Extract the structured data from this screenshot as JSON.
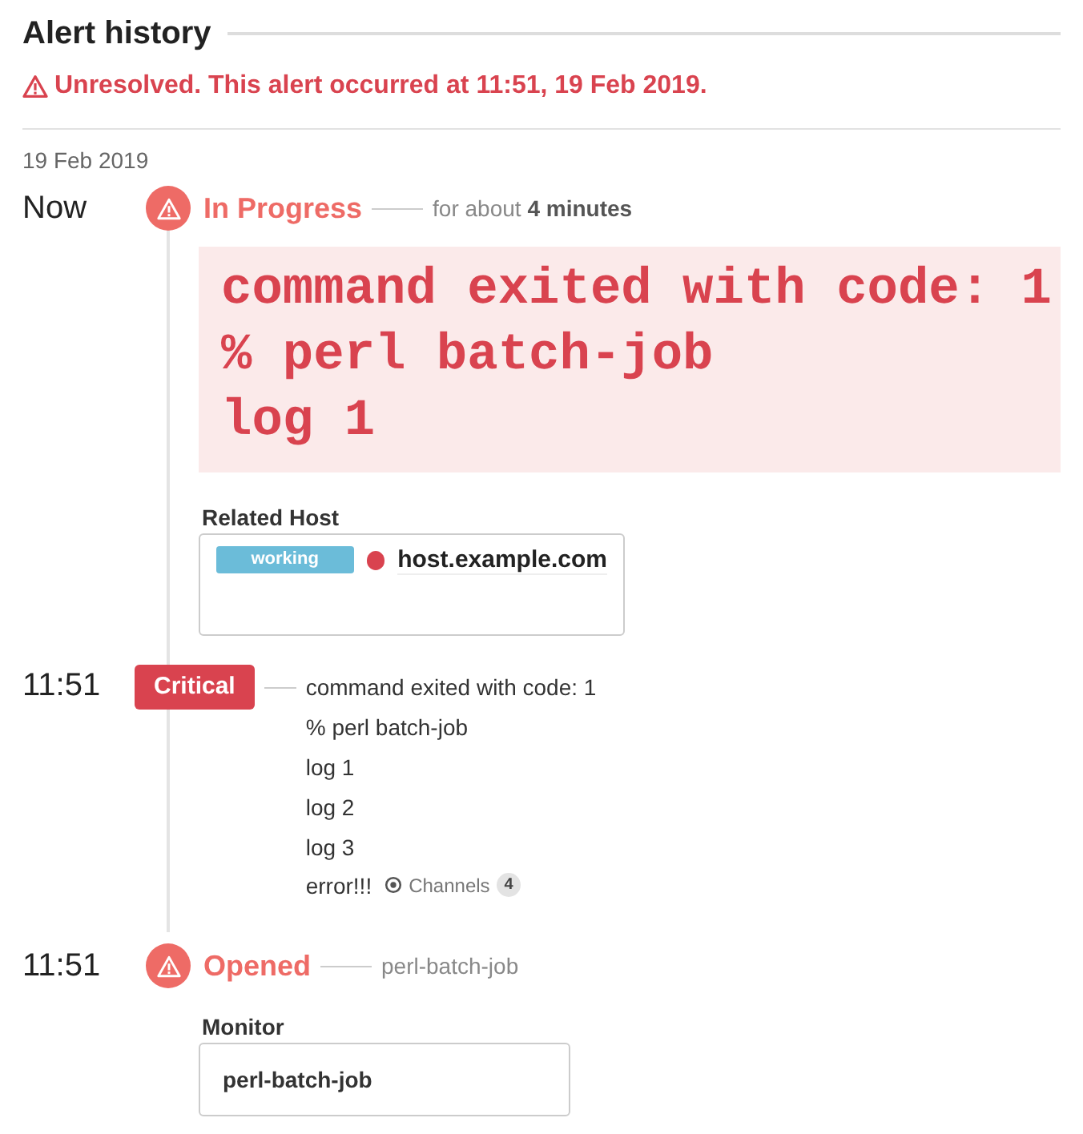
{
  "header": {
    "title": "Alert history",
    "status": "Unresolved. This alert occurred at 11:51, 19 Feb 2019."
  },
  "date": "19 Feb 2019",
  "events": [
    {
      "kind": "state",
      "time": "Now",
      "label": "In Progress",
      "detail": "for about **4 minutes**",
      "message_lines": [
        "command exited with code: 1",
        "% perl batch-job",
        "log 1"
      ],
      "related_host": {
        "label": "Related Host",
        "status": "working",
        "name": "host.example.com"
      }
    },
    {
      "kind": "severity",
      "time": "11:51",
      "label": "Critical",
      "lines": [
        "command exited with code: 1",
        "% perl batch-job",
        "log 1",
        "log 2",
        "log 3",
        "error!!!"
      ],
      "channels": {
        "label": "Channels",
        "count": "4"
      }
    },
    {
      "kind": "state",
      "time": "11:51",
      "label": "Opened",
      "detail": "perl-batch-job",
      "monitor": {
        "label": "Monitor",
        "name": "perl-batch-job"
      }
    }
  ]
}
